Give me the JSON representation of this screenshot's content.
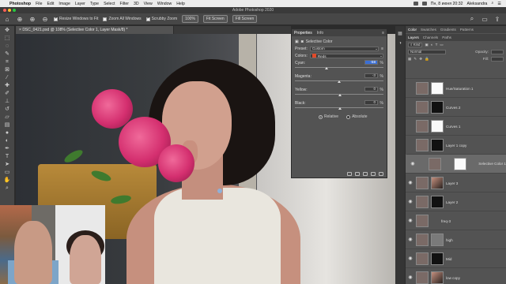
{
  "menubar": {
    "app": "Photoshop",
    "items": [
      "File",
      "Edit",
      "Image",
      "Layer",
      "Type",
      "Select",
      "Filter",
      "3D",
      "View",
      "Window",
      "Help"
    ],
    "clock": "Пн, 8 июня  20:32",
    "user": "Aleksandra"
  },
  "window_title": "Adobe Photoshop 2020",
  "options": {
    "resize_windows": "Resize Windows to Fit",
    "zoom_all": "Zoom All Windows",
    "scrubby": "Scrubby Zoom",
    "zoom_level": "100%",
    "fit_screen": "Fit Screen",
    "fill_screen": "Fill Screen"
  },
  "document": {
    "tab_title": "DSC_0421.psd @ 108% (Selective Color 1, Layer Mask/8) *"
  },
  "properties": {
    "tab_properties": "Properties",
    "tab_info": "Info",
    "adjustment": "Selective Color",
    "preset_label": "Preset:",
    "preset_value": "Custom",
    "colors_label": "Colors:",
    "colors_value": "Reds",
    "sliders": [
      {
        "label": "Cyan:",
        "value": "-58",
        "position": 0.35,
        "active": true
      },
      {
        "label": "Magenta:",
        "value": "-3",
        "position": 0.49,
        "active": false
      },
      {
        "label": "Yellow:",
        "value": "0",
        "position": 0.5,
        "active": false
      },
      {
        "label": "Black:",
        "value": "0",
        "position": 0.5,
        "active": false
      }
    ],
    "pct": "%",
    "method_relative": "Relative",
    "method_absolute": "Absolute",
    "method_selected": "Relative"
  },
  "panels": {
    "top_tabs": [
      "Color",
      "Swatches",
      "Gradients",
      "Patterns"
    ],
    "layer_tabs": [
      "Layers",
      "Channels",
      "Paths"
    ],
    "kind_filter": "Kind",
    "blend_mode": "Normal",
    "opacity_label": "Opacity:",
    "fill_label": "Fill:"
  },
  "layers": [
    {
      "name": "Hue/Saturation 1",
      "thumb": "mask-white",
      "visible": false,
      "selected": false
    },
    {
      "name": "Curves 2",
      "thumb": "mask-black",
      "visible": false,
      "selected": false
    },
    {
      "name": "Curves 1",
      "thumb": "mask-white",
      "visible": false,
      "selected": false
    },
    {
      "name": "Layer 1 copy",
      "thumb": "mask-black",
      "visible": false,
      "selected": false
    },
    {
      "name": "Selective Color 1",
      "thumb": "mask-white",
      "visible": true,
      "selected": true
    },
    {
      "name": "Layer 3",
      "thumb": "photo",
      "visible": true,
      "selected": false
    },
    {
      "name": "Layer 2",
      "thumb": "mask-black",
      "visible": true,
      "selected": false
    },
    {
      "name": "freq-3",
      "thumb": "folder",
      "visible": true,
      "selected": false
    },
    {
      "name": "high",
      "thumb": "gray",
      "visible": true,
      "selected": false
    },
    {
      "name": "Mid",
      "thumb": "mask-black",
      "visible": true,
      "selected": false
    },
    {
      "name": "low copy",
      "thumb": "photo",
      "visible": true,
      "selected": false
    }
  ],
  "colors": {
    "accent": "#3a6fd6",
    "swatch_reds": "#e04a2a"
  }
}
